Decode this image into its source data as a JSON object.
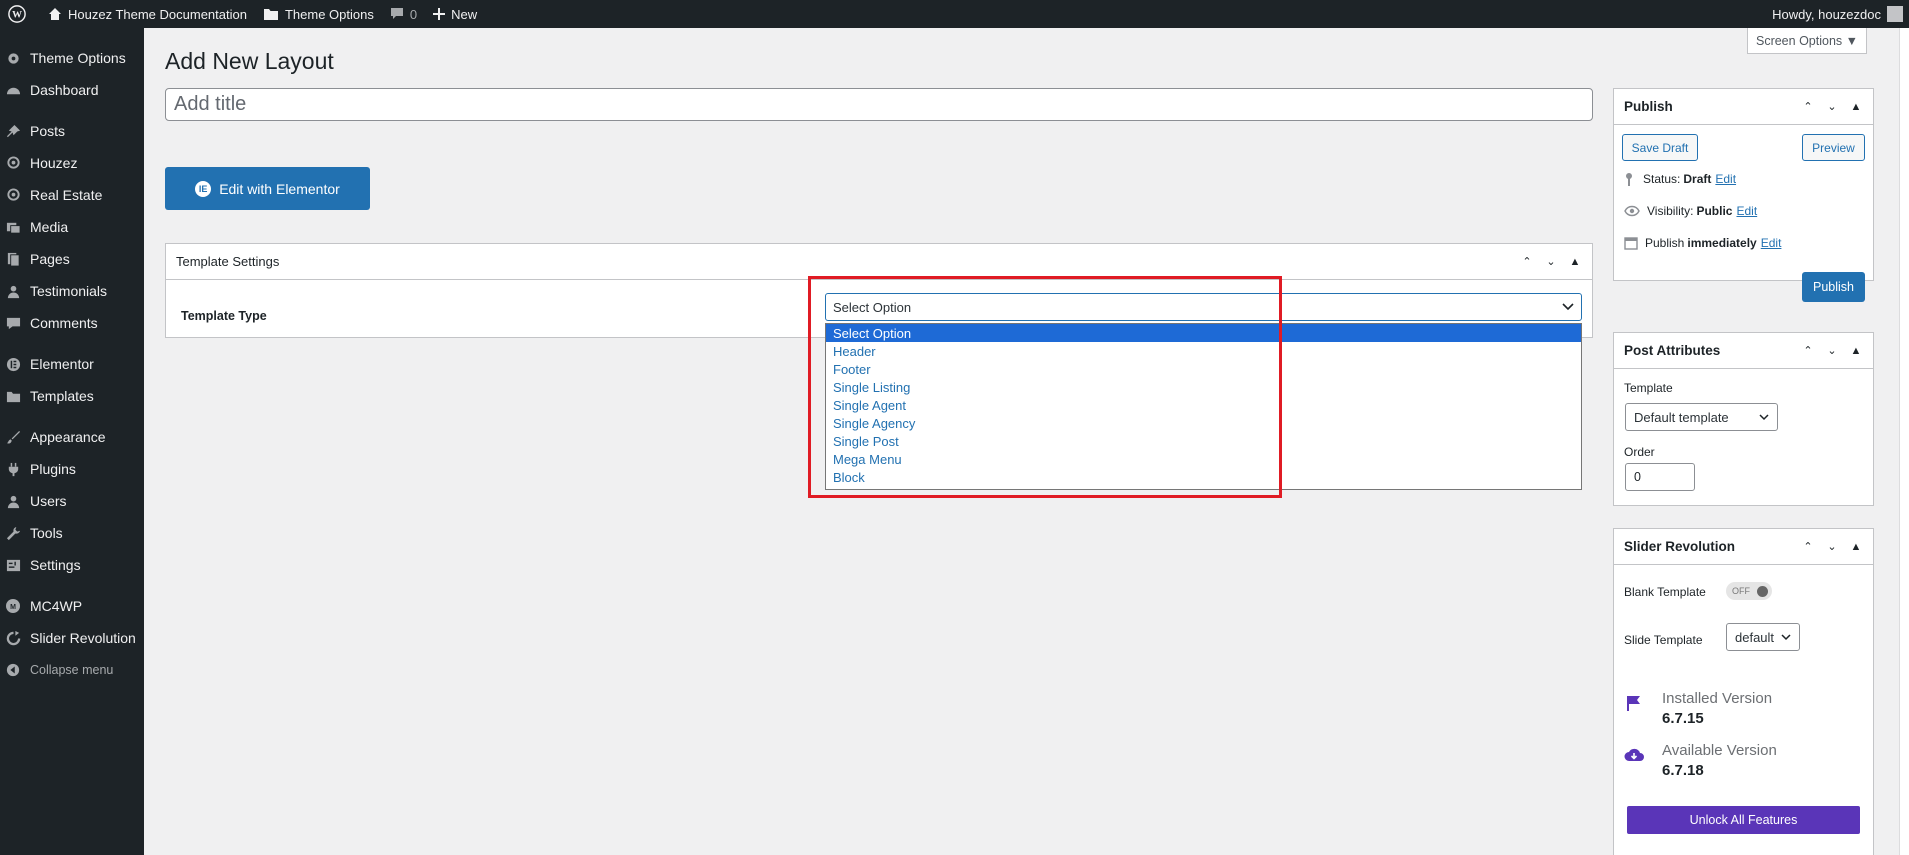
{
  "admin_bar": {
    "site_name": "Houzez Theme Documentation",
    "theme_options": "Theme Options",
    "comments_count": "0",
    "new_label": "New",
    "howdy": "Howdy, houzezdoc"
  },
  "sidebar": {
    "items": [
      {
        "label": "Theme Options",
        "icon": "gear-icon"
      },
      {
        "label": "Dashboard",
        "icon": "dashboard-icon"
      },
      {
        "label": "Posts",
        "icon": "pin-icon"
      },
      {
        "label": "Houzez",
        "icon": "location-icon"
      },
      {
        "label": "Real Estate",
        "icon": "location-icon"
      },
      {
        "label": "Media",
        "icon": "media-icon"
      },
      {
        "label": "Pages",
        "icon": "pages-icon"
      },
      {
        "label": "Testimonials",
        "icon": "person-icon"
      },
      {
        "label": "Comments",
        "icon": "comment-icon"
      },
      {
        "label": "Elementor",
        "icon": "elementor-icon"
      },
      {
        "label": "Templates",
        "icon": "folder-icon"
      },
      {
        "label": "Appearance",
        "icon": "brush-icon"
      },
      {
        "label": "Plugins",
        "icon": "plug-icon"
      },
      {
        "label": "Users",
        "icon": "users-icon"
      },
      {
        "label": "Tools",
        "icon": "wrench-icon"
      },
      {
        "label": "Settings",
        "icon": "settings-icon"
      },
      {
        "label": "MC4WP",
        "icon": "mc4wp-icon"
      },
      {
        "label": "Slider Revolution",
        "icon": "refresh-icon"
      }
    ],
    "collapse_label": "Collapse menu"
  },
  "screen_options": "Screen Options ▼",
  "page_title": "Add New Layout",
  "title_placeholder": "Add title",
  "edit_elementor": "Edit with Elementor",
  "template_settings": {
    "title": "Template Settings",
    "field_label": "Template Type",
    "selected": "Select Option",
    "options": [
      "Select Option",
      "Header",
      "Footer",
      "Single Listing",
      "Single Agent",
      "Single Agency",
      "Single Post",
      "Mega Menu",
      "Block"
    ]
  },
  "publish": {
    "title": "Publish",
    "save_draft": "Save Draft",
    "preview": "Preview",
    "status_label": "Status:",
    "status_value": "Draft",
    "visibility_label": "Visibility:",
    "visibility_value": "Public",
    "publish_label": "Publish",
    "publish_value": "immediately",
    "edit": "Edit",
    "publish_button": "Publish"
  },
  "post_attributes": {
    "title": "Post Attributes",
    "template_label": "Template",
    "template_value": "Default template",
    "order_label": "Order",
    "order_value": "0"
  },
  "slider_revolution": {
    "title": "Slider Revolution",
    "blank_template": "Blank Template",
    "toggle_state": "OFF",
    "slide_template": "Slide Template",
    "slide_template_value": "default",
    "installed_label": "Installed Version",
    "installed_version": "6.7.15",
    "available_label": "Available Version",
    "available_version": "6.7.18",
    "unlock": "Unlock All Features"
  }
}
